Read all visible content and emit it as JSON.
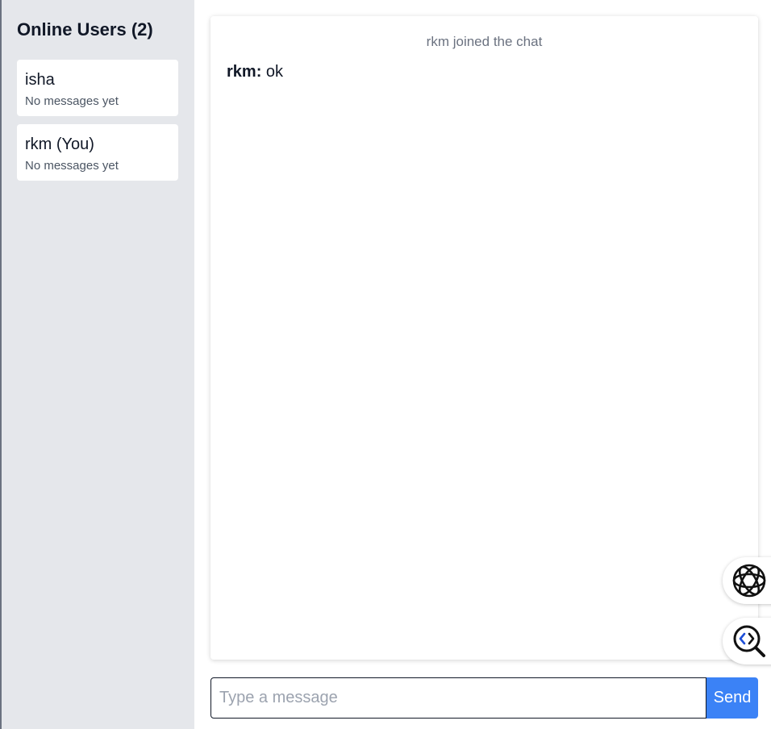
{
  "sidebar": {
    "title": "Online Users (2)",
    "users": [
      {
        "name": "isha",
        "last_message": "No messages yet"
      },
      {
        "name": "rkm (You)",
        "last_message": "No messages yet"
      }
    ]
  },
  "chat": {
    "system_message": "rkm joined the chat",
    "messages": [
      {
        "sender": "rkm:",
        "text": "ok"
      }
    ]
  },
  "composer": {
    "placeholder": "Type a message",
    "value": "",
    "send_label": "Send"
  },
  "floating_widgets": [
    {
      "icon": "ai-assistant-icon"
    },
    {
      "icon": "code-search-icon"
    }
  ],
  "colors": {
    "sidebar_bg": "#e5e7eb",
    "accent": "#3b82f6",
    "muted_text": "#6b7280"
  }
}
